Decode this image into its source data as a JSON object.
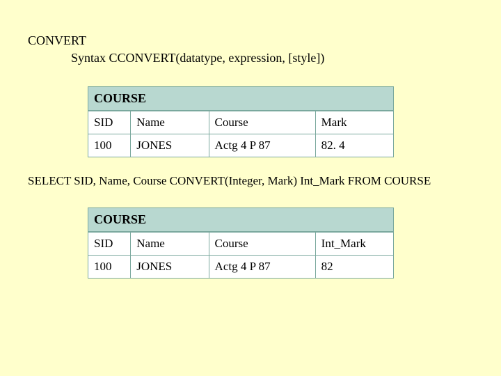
{
  "heading": "CONVERT",
  "syntax": "Syntax CCONVERT(datatype, expression, [style])",
  "query": "SELECT SID, Name, Course CONVERT(Integer, Mark) Int_Mark FROM COURSE",
  "table1": {
    "title": "COURSE",
    "cols": [
      "SID",
      "Name",
      "Course",
      "Mark"
    ],
    "row": [
      "100",
      "JONES",
      "Actg 4 P 87",
      "82. 4"
    ]
  },
  "table2": {
    "title": "COURSE",
    "cols": [
      "SID",
      "Name",
      "Course",
      "Int_Mark"
    ],
    "row": [
      "100",
      "JONES",
      "Actg 4 P 87",
      "82"
    ]
  }
}
